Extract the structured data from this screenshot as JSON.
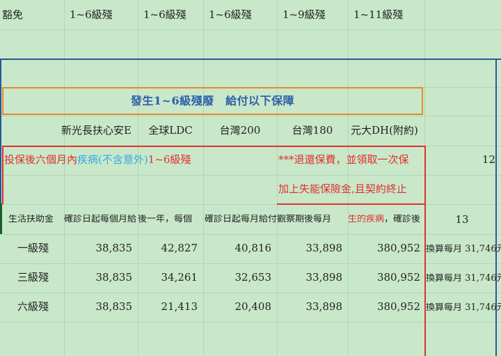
{
  "row_top": {
    "label": "豁免",
    "cols": [
      "1~6級殘",
      "1~6級殘",
      "1~6級殘",
      "1~9級殘",
      "1~11級殘"
    ]
  },
  "banner": {
    "title": "發生1~6級殘廢　給付以下保障"
  },
  "products": [
    "新光長扶心安E",
    "全球LDC",
    "台灣200",
    "台灣180",
    "元大DH(附約)"
  ],
  "refund_row": {
    "left_prefix": "投保後六個月內",
    "left_mid": "疾病(不含意外)",
    "left_suffix": "1~6級殘",
    "notice": "***退還保費，並領取一次保",
    "right_value": "12"
  },
  "loss_row": {
    "text": "加上失能保險金,且契約終止"
  },
  "benefit_row": {
    "label": "生活扶助金",
    "c1": "確診日起每個月給",
    "c2": "後一年，每個",
    "c3": "確診日起每月給付",
    "c4": "觀察期後每月",
    "c5_red": "生的疾病",
    "c5_tail": "，確診後",
    "right_value": "13"
  },
  "levels": [
    {
      "name": "一級殘",
      "v1": "38,835",
      "v2": "42,827",
      "v3": "40,816",
      "v4": "33,898",
      "v5": "380,952",
      "note": "換算每月 31,746元"
    },
    {
      "name": "三級殘",
      "v1": "38,835",
      "v2": "34,261",
      "v3": "32,653",
      "v4": "33,898",
      "v5": "380,952",
      "note": "換算每月 31,746元"
    },
    {
      "name": "六級殘",
      "v1": "38,835",
      "v2": "21,413",
      "v3": "20,408",
      "v4": "33,898",
      "v5": "380,952",
      "note": "換算每月 31,746元"
    }
  ]
}
